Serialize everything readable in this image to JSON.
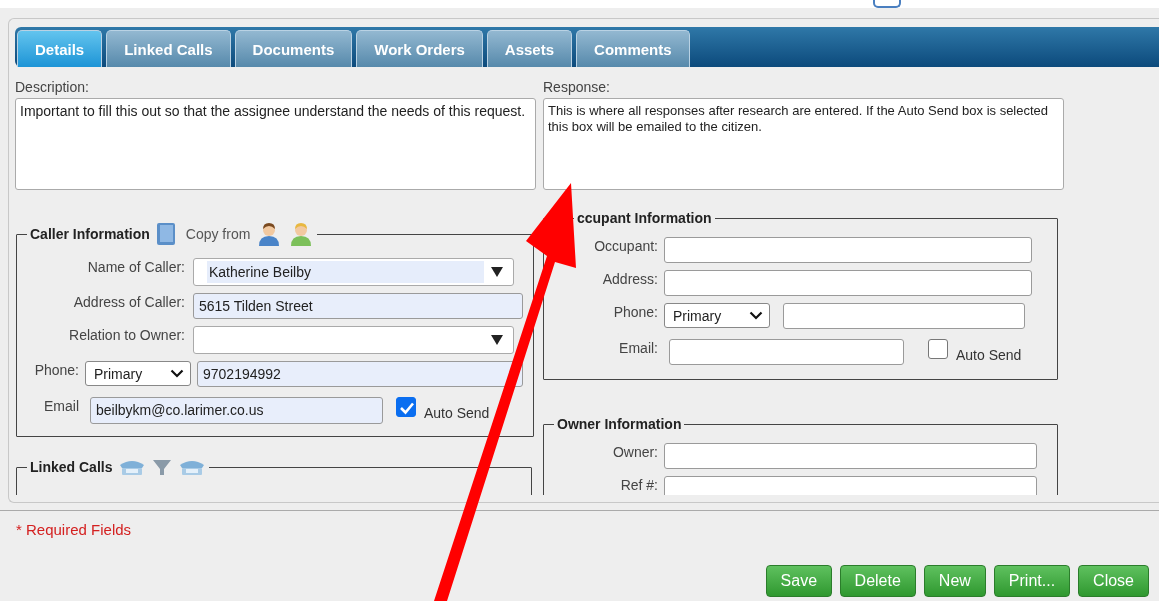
{
  "tabs": [
    {
      "label": "Details",
      "selected": true
    },
    {
      "label": "Linked Calls",
      "selected": false
    },
    {
      "label": "Documents",
      "selected": false
    },
    {
      "label": "Work Orders",
      "selected": false
    },
    {
      "label": "Assets",
      "selected": false
    },
    {
      "label": "Comments",
      "selected": false
    }
  ],
  "description": {
    "label": "Description:",
    "value": "Important to fill this out so that the assignee understand the needs of this request."
  },
  "response": {
    "label": "Response:",
    "value": "This is where all responses after research are entered.  If the Auto Send box is selected this box will be emailed to the citizen."
  },
  "caller_information": {
    "title": "Caller Information",
    "copy_from": "Copy from",
    "fields": [
      {
        "kind": "combo",
        "label": "Name of Caller:",
        "value": "Katherine Beilby"
      },
      {
        "kind": "text",
        "label": "Address of Caller:",
        "value": "5615 Tilden Street"
      },
      {
        "kind": "combo",
        "label": "Relation to Owner:"
      },
      {
        "kind": "phone",
        "label": "Phone:",
        "type": "Primary",
        "value": "9702194992"
      },
      {
        "kind": "email",
        "label": "Email",
        "value": "beilbykm@co.larimer.co.us",
        "auto_send": {
          "label": "Auto Send",
          "checked": true
        }
      }
    ]
  },
  "linked_calls": {
    "title": "Linked Calls"
  },
  "occupant_information": {
    "title": "ccupant Information",
    "fields": [
      {
        "kind": "text",
        "label": "Occupant:"
      },
      {
        "kind": "text",
        "label": "Address:"
      },
      {
        "kind": "phone",
        "label": "Phone:",
        "type": "Primary"
      },
      {
        "kind": "email",
        "label": "Email:",
        "auto_send": {
          "label": "Auto Send",
          "checked": false
        }
      }
    ]
  },
  "owner_information": {
    "title": "Owner Information",
    "fields": [
      {
        "kind": "text",
        "label": "Owner:"
      },
      {
        "kind": "text",
        "label": "Ref #:"
      }
    ]
  },
  "required_note": "* Required Fields",
  "buttons": [
    "Save",
    "Delete",
    "New",
    "Print...",
    "Close"
  ]
}
